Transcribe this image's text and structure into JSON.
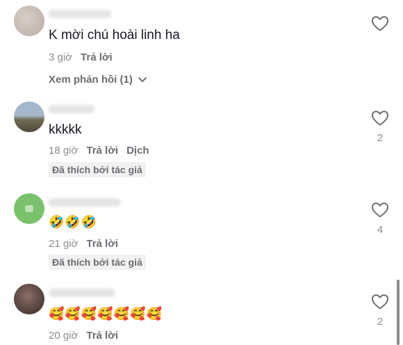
{
  "comments": [
    {
      "text": "K mời chú hoài linh ha",
      "time": "3 giờ",
      "reply": "Trả lời",
      "view_replies": "Xem phản hồi (1)",
      "likes": ""
    },
    {
      "text": "kkkkk",
      "time": "18 giờ",
      "reply": "Trả lời",
      "translate": "Dịch",
      "badge": "Đã thích bởi tác giả",
      "likes": "2"
    },
    {
      "text": "🤣🤣🤣",
      "time": "21 giờ",
      "reply": "Trả lời",
      "badge": "Đã thích bởi tác giả",
      "likes": "4"
    },
    {
      "text": "🥰🥰🥰🥰🥰🥰🥰",
      "time": "20 giờ",
      "reply": "Trả lời",
      "likes": "2"
    }
  ],
  "icons": {
    "like": "heart-outline-icon",
    "expand": "chevron-down-icon"
  },
  "colors": {
    "text": "#161823",
    "muted": "#8a8b91",
    "badge_bg": "#f1f1f2"
  }
}
